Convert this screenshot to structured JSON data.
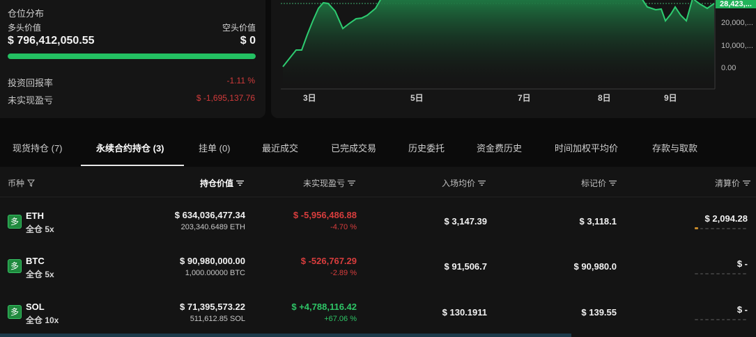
{
  "position_distribution": {
    "title": "仓位分布",
    "long_label": "多头价值",
    "short_label": "空头价值",
    "long_value": "$ 796,412,050.55",
    "short_value": "$ 0",
    "long_ratio": 1.0,
    "roi_label": "投资回报率",
    "roi_value": "-1.11 %",
    "upnl_label": "未实现盈亏",
    "upnl_value": "$ -1,695,137.76"
  },
  "chart": {
    "y_ticks": [
      "20,000,...",
      "10,000,...",
      "0.00"
    ],
    "x_ticks": [
      "3日",
      "5日",
      "7日",
      "8日",
      "9日"
    ],
    "current_label": "28,423,...",
    "colors": {
      "line": "#2ecc71",
      "fill_top": "#1f7a44",
      "label_bg": "#22b35a"
    }
  },
  "tabs": [
    {
      "label": "现货持仓 (7)",
      "active": false
    },
    {
      "label": "永续合约持仓 (3)",
      "active": true
    },
    {
      "label": "挂单 (0)",
      "active": false
    },
    {
      "label": "最近成交",
      "active": false
    },
    {
      "label": "已完成交易",
      "active": false
    },
    {
      "label": "历史委托",
      "active": false
    },
    {
      "label": "资金费历史",
      "active": false
    },
    {
      "label": "时间加权平均价",
      "active": false
    },
    {
      "label": "存款与取款",
      "active": false
    }
  ],
  "table": {
    "headers": {
      "coin": "币种",
      "position_value": "持仓价值",
      "upnl": "未实现盈亏",
      "entry_price": "入场均价",
      "mark_price": "标记价",
      "liq_price": "清算价"
    },
    "rows": [
      {
        "badge": "多",
        "symbol": "ETH",
        "mode": "全仓 5x",
        "value": "$ 634,036,477.34",
        "size": "203,340.6489 ETH",
        "pnl": "$ -5,956,486.88",
        "pnl_pct": "-4.70 %",
        "pnl_positive": false,
        "entry": "$ 3,147.39",
        "mark": "$ 3,118.1",
        "liq": "$ 2,094.28",
        "liq_level": 1
      },
      {
        "badge": "多",
        "symbol": "BTC",
        "mode": "全仓 5x",
        "value": "$ 90,980,000.00",
        "size": "1,000.00000 BTC",
        "pnl": "$ -526,767.29",
        "pnl_pct": "-2.89 %",
        "pnl_positive": false,
        "entry": "$ 91,506.7",
        "mark": "$ 90,980.0",
        "liq": "$ -",
        "liq_level": 0
      },
      {
        "badge": "多",
        "symbol": "SOL",
        "mode": "全仓 10x",
        "value": "$ 71,395,573.22",
        "size": "511,612.85 SOL",
        "pnl": "$ +4,788,116.42",
        "pnl_pct": "+67.06 %",
        "pnl_positive": true,
        "entry": "$ 130.1911",
        "mark": "$ 139.55",
        "liq": "$ -",
        "liq_level": 0
      }
    ]
  }
}
